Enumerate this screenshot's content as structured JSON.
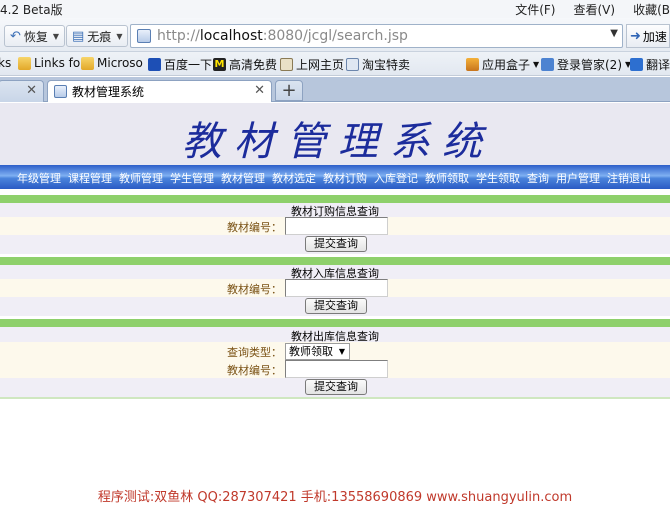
{
  "browser": {
    "app_title": "4.2 Beta版",
    "menu": [
      "文件(F)",
      "查看(V)",
      "收藏(B"
    ],
    "nav": {
      "back_label": "恢复",
      "traceless_label": "无痕"
    },
    "address": {
      "url_prefix": "http://",
      "url_host": "localhost",
      "url_rest": ":8080/jcgl/search.jsp"
    },
    "accelerate_label": "加速",
    "bookmarks": [
      "ks",
      "Links fo",
      "Microso",
      "百度一下",
      "高清免费",
      "上网主页",
      "淘宝特卖",
      "应用盒子",
      "登录管家(2)",
      "翻译"
    ],
    "tabs": [
      {
        "label": ""
      },
      {
        "label": "教材管理系统"
      }
    ]
  },
  "page": {
    "system_title": "教材管理系统",
    "nav_items": [
      "年级管理",
      "课程管理",
      "教师管理",
      "学生管理",
      "教材管理",
      "教材选定",
      "教材订购",
      "入库登记",
      "教师领取",
      "学生领取",
      "查询",
      "用户管理",
      "注销退出"
    ],
    "sections": [
      {
        "title": "教材订购信息查询",
        "field_label": "教材编号：",
        "submit_label": "提交查询"
      },
      {
        "title": "教材入库信息查询",
        "field_label": "教材编号：",
        "submit_label": "提交查询"
      },
      {
        "title": "教材出库信息查询",
        "type_label": "查询类型：",
        "type_value": "教师领取",
        "field_label": "教材编号：",
        "submit_label": "提交查询"
      }
    ],
    "footer": "程序测试:双鱼林 QQ:287307421 手机:13558690869 www.shuangyulin.com"
  },
  "colors": {
    "title_blue": "#1c2c9c",
    "nav_blue": "#2c5ec9",
    "section_green": "#8ed06b",
    "label_brown": "#7a5214",
    "footer_red": "#c0392b"
  }
}
